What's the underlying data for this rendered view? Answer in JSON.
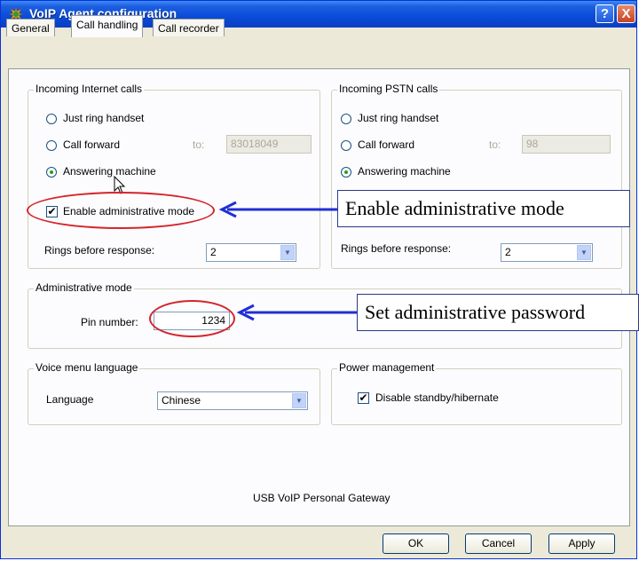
{
  "window": {
    "title": "VoIP Agent configuration",
    "help_label": "?",
    "close_label": "X"
  },
  "tabs": [
    {
      "label": "General"
    },
    {
      "label": "Call handling"
    },
    {
      "label": "Call recorder"
    }
  ],
  "internet": {
    "title": "Incoming Internet calls",
    "ring_label": "Just ring handset",
    "forward_label": "Call forward",
    "to_label": "to:",
    "forward_value": "83018049",
    "answer_label": "Answering machine",
    "admin_label": "Enable administrative mode",
    "admin_checked": "✔",
    "rings_label": "Rings before response:",
    "rings_value": "2"
  },
  "pstn": {
    "title": "Incoming PSTN calls",
    "ring_label": "Just ring handset",
    "forward_label": "Call forward",
    "to_label": "to:",
    "forward_value": "98",
    "answer_label": "Answering machine",
    "rings_label": "Rings before response:",
    "rings_value": "2"
  },
  "admin_mode": {
    "title": "Administrative mode",
    "pin_label": "Pin number:",
    "pin_value": "1234"
  },
  "voice_menu": {
    "title": "Voice menu language",
    "language_label": "Language",
    "language_value": "Chinese"
  },
  "power": {
    "title": "Power management",
    "standby_label": "Disable standby/hibernate",
    "standby_checked": "✔"
  },
  "footer_text": "USB VoIP Personal Gateway",
  "buttons": {
    "ok": "OK",
    "cancel": "Cancel",
    "apply": "Apply"
  },
  "callouts": {
    "admin": "Enable administrative mode",
    "password": "Set administrative password"
  },
  "colors": {
    "annotation_arrow": "#1f2fd6",
    "annotation_ellipse": "#d4252b"
  }
}
